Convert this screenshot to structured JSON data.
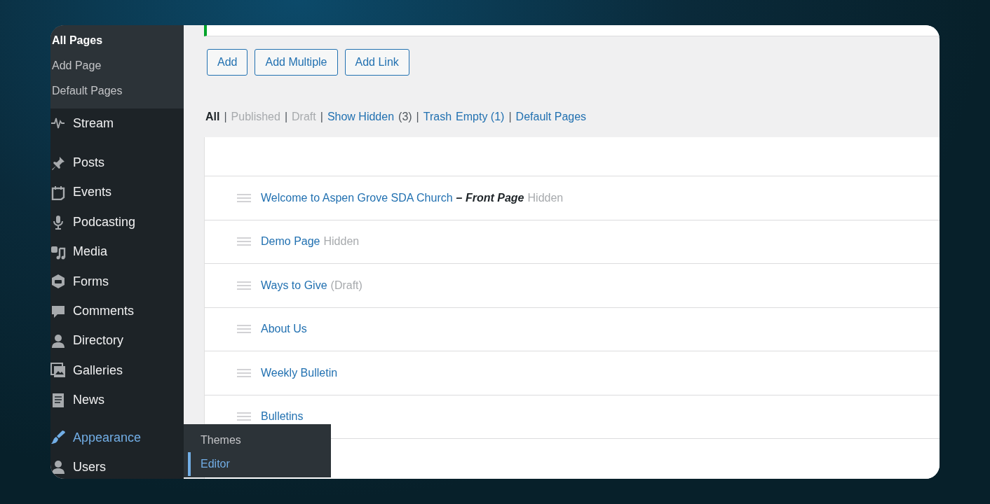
{
  "sidebar": {
    "submenu": [
      {
        "label": "All Pages",
        "selected": true
      },
      {
        "label": "Add Page",
        "selected": false
      },
      {
        "label": "Default Pages",
        "selected": false
      }
    ],
    "menu": [
      {
        "label": "Stream",
        "selected": false
      },
      {
        "label": "Posts",
        "selected": false
      },
      {
        "label": "Events",
        "selected": false
      },
      {
        "label": "Podcasting",
        "selected": false
      },
      {
        "label": "Media",
        "selected": false
      },
      {
        "label": "Forms",
        "selected": false
      },
      {
        "label": "Comments",
        "selected": false
      },
      {
        "label": "Directory",
        "selected": false
      },
      {
        "label": "Galleries",
        "selected": false
      },
      {
        "label": "News",
        "selected": false
      },
      {
        "label": "Appearance",
        "selected": true
      },
      {
        "label": "Users",
        "selected": false
      }
    ],
    "flyout": [
      {
        "label": "Themes",
        "selected": false
      },
      {
        "label": "Editor",
        "selected": true
      }
    ]
  },
  "buttons": [
    "Add",
    "Add Multiple",
    "Add Link"
  ],
  "filters": [
    {
      "label": "All",
      "kind": "current",
      "separator": "|"
    },
    {
      "label": "Published",
      "kind": "disabled",
      "separator": "|"
    },
    {
      "label": "Draft",
      "kind": "disabled",
      "separator": "|"
    },
    {
      "label": "Show Hidden",
      "kind": "link",
      "count": "(3)",
      "separator": "|"
    },
    {
      "label": "Trash",
      "kind": "link"
    },
    {
      "label": "Empty (1)",
      "kind": "link",
      "separator": "|"
    },
    {
      "label": "Default Pages",
      "kind": "link"
    }
  ],
  "pages": [
    {
      "title": "Welcome to Aspen Grove SDA Church",
      "note": "– Front Page",
      "status": "Hidden"
    },
    {
      "title": "Demo Page",
      "status": "Hidden"
    },
    {
      "title": "Ways to Give",
      "status": "(Draft)"
    },
    {
      "title": "About Us"
    },
    {
      "title": "Weekly Bulletin"
    },
    {
      "title": "Bulletins"
    }
  ]
}
